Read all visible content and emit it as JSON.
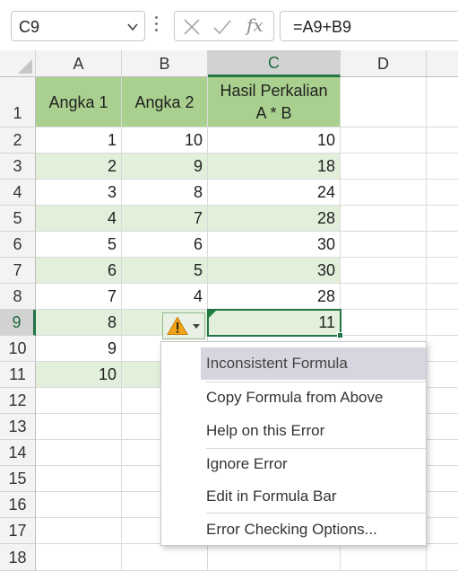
{
  "formula_bar": {
    "name_box": "C9",
    "formula": "=A9+B9",
    "fx_label": "fx",
    "cancel_icon": "close-icon",
    "enter_icon": "check-icon"
  },
  "columns": [
    "A",
    "B",
    "C",
    "D"
  ],
  "rows": [
    "1",
    "2",
    "3",
    "4",
    "5",
    "6",
    "7",
    "8",
    "9",
    "10",
    "11",
    "12",
    "13",
    "14",
    "15",
    "16",
    "17",
    "18"
  ],
  "header_row": {
    "a": "Angka 1",
    "b": "Angka 2",
    "c_line1": "Hasil Perkalian",
    "c_line2": "A * B"
  },
  "data_rows": [
    {
      "a": "1",
      "b": "10",
      "c": "10"
    },
    {
      "a": "2",
      "b": "9",
      "c": "18"
    },
    {
      "a": "3",
      "b": "8",
      "c": "24"
    },
    {
      "a": "4",
      "b": "7",
      "c": "28"
    },
    {
      "a": "5",
      "b": "6",
      "c": "30"
    },
    {
      "a": "6",
      "b": "5",
      "c": "30"
    },
    {
      "a": "7",
      "b": "4",
      "c": "28"
    },
    {
      "a": "8",
      "b": "",
      "c": "11"
    },
    {
      "a": "9",
      "b": "",
      "c": ""
    },
    {
      "a": "10",
      "b": "",
      "c": ""
    }
  ],
  "error_menu": {
    "title": "Inconsistent Formula",
    "items": [
      "Copy Formula from Above",
      "Help on this Error",
      "Ignore Error",
      "Edit in Formula Bar",
      "Error Checking Options..."
    ]
  },
  "colors": {
    "header_fill": "#a9d08e",
    "band_fill": "#e2efda",
    "selection": "#217346",
    "warning": "#f2a51a"
  }
}
